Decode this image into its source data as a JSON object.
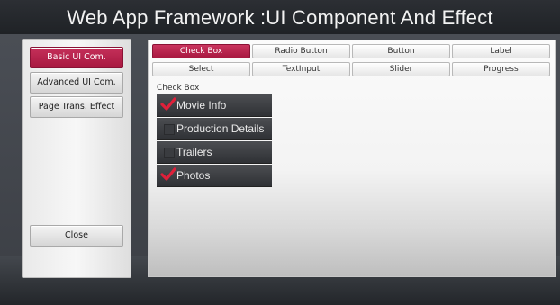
{
  "app": {
    "title": "Web App Framework :UI Component And Effect"
  },
  "sidebar": {
    "items": [
      {
        "label": "Basic UI Com.",
        "active": true
      },
      {
        "label": "Advanced UI Com.",
        "active": false
      },
      {
        "label": "Page Trans. Effect",
        "active": false
      }
    ],
    "close_label": "Close"
  },
  "tabs": {
    "row1": [
      {
        "label": "Check Box",
        "active": true
      },
      {
        "label": "Radio Button",
        "active": false
      },
      {
        "label": "Button",
        "active": false
      },
      {
        "label": "Label",
        "active": false
      }
    ],
    "row2": [
      {
        "label": "Select",
        "active": false
      },
      {
        "label": "TextInput",
        "active": false
      },
      {
        "label": "Slider",
        "active": false
      },
      {
        "label": "Progress",
        "active": false
      }
    ]
  },
  "checkbox_section": {
    "label": "Check Box",
    "items": [
      {
        "label": "Movie Info",
        "checked": true
      },
      {
        "label": "Production Details",
        "checked": false
      },
      {
        "label": "Trailers",
        "checked": false
      },
      {
        "label": "Photos",
        "checked": true
      }
    ]
  },
  "colors": {
    "accent": "#b82350",
    "check": "#e0203a"
  }
}
